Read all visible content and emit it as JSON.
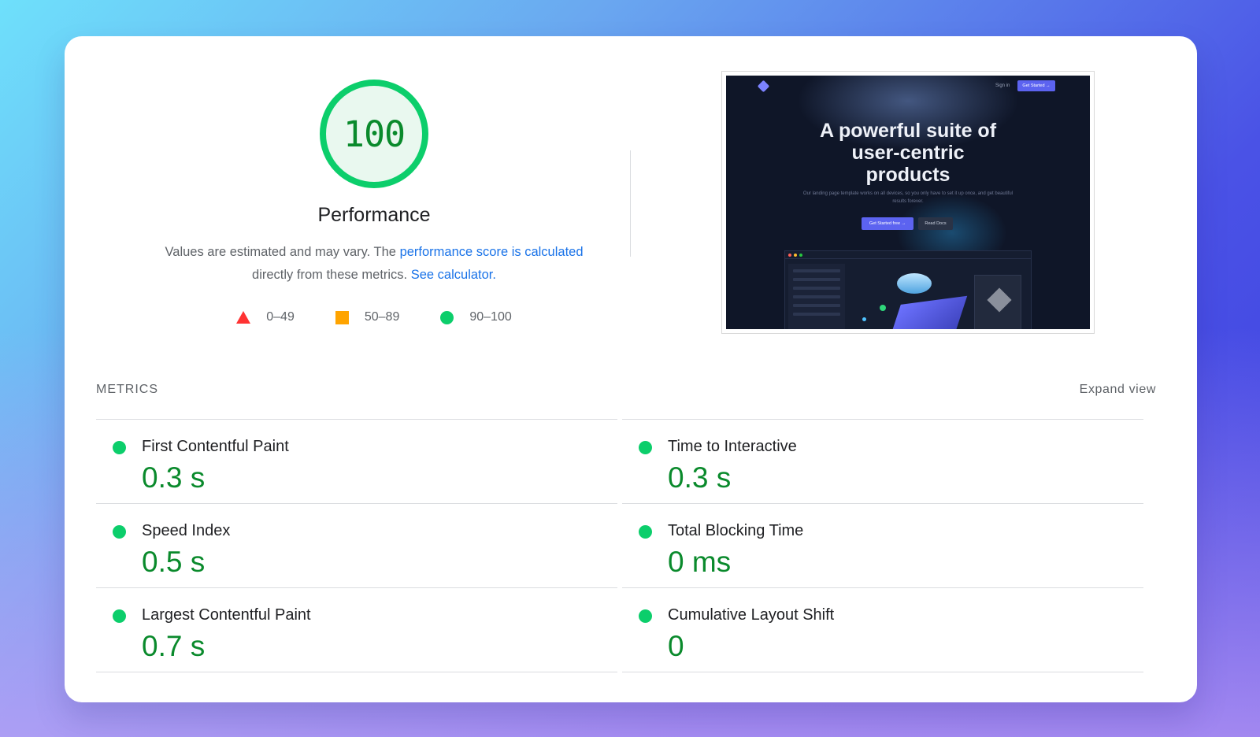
{
  "score": {
    "value": "100",
    "title": "Performance",
    "desc_prefix": "Values are estimated and may vary. The ",
    "desc_link1": "performance score is calculated",
    "desc_mid": "directly from these metrics. ",
    "desc_link2": "See calculator."
  },
  "legend": [
    {
      "icon": "triangle-red",
      "label": "0–49",
      "color": "#ff3333"
    },
    {
      "icon": "square-orange",
      "label": "50–89",
      "color": "#ffa400"
    },
    {
      "icon": "circle-green",
      "label": "90–100",
      "color": "#0cce6b"
    }
  ],
  "thumbnail": {
    "nav_signin": "Sign in",
    "nav_cta": "Get Started →",
    "headline": "A powerful suite of user-centric products",
    "subtext": "Our landing page template works on all devices, so you only have to set it up once, and get beautiful results forever.",
    "btn_primary": "Get Started free →",
    "btn_secondary": "Read Docs"
  },
  "metrics": {
    "heading": "METRICS",
    "expand_label": "Expand view",
    "left": [
      {
        "label": "First Contentful Paint",
        "value": "0.3 s"
      },
      {
        "label": "Speed Index",
        "value": "0.5 s"
      },
      {
        "label": "Largest Contentful Paint",
        "value": "0.7 s"
      }
    ],
    "right": [
      {
        "label": "Time to Interactive",
        "value": "0.3 s"
      },
      {
        "label": "Total Blocking Time",
        "value": "0 ms"
      },
      {
        "label": "Cumulative Layout Shift",
        "value": "0"
      }
    ]
  },
  "colors": {
    "pass": "#0cce6b",
    "pass_text": "#0a8a2c",
    "link": "#1a73e8"
  }
}
